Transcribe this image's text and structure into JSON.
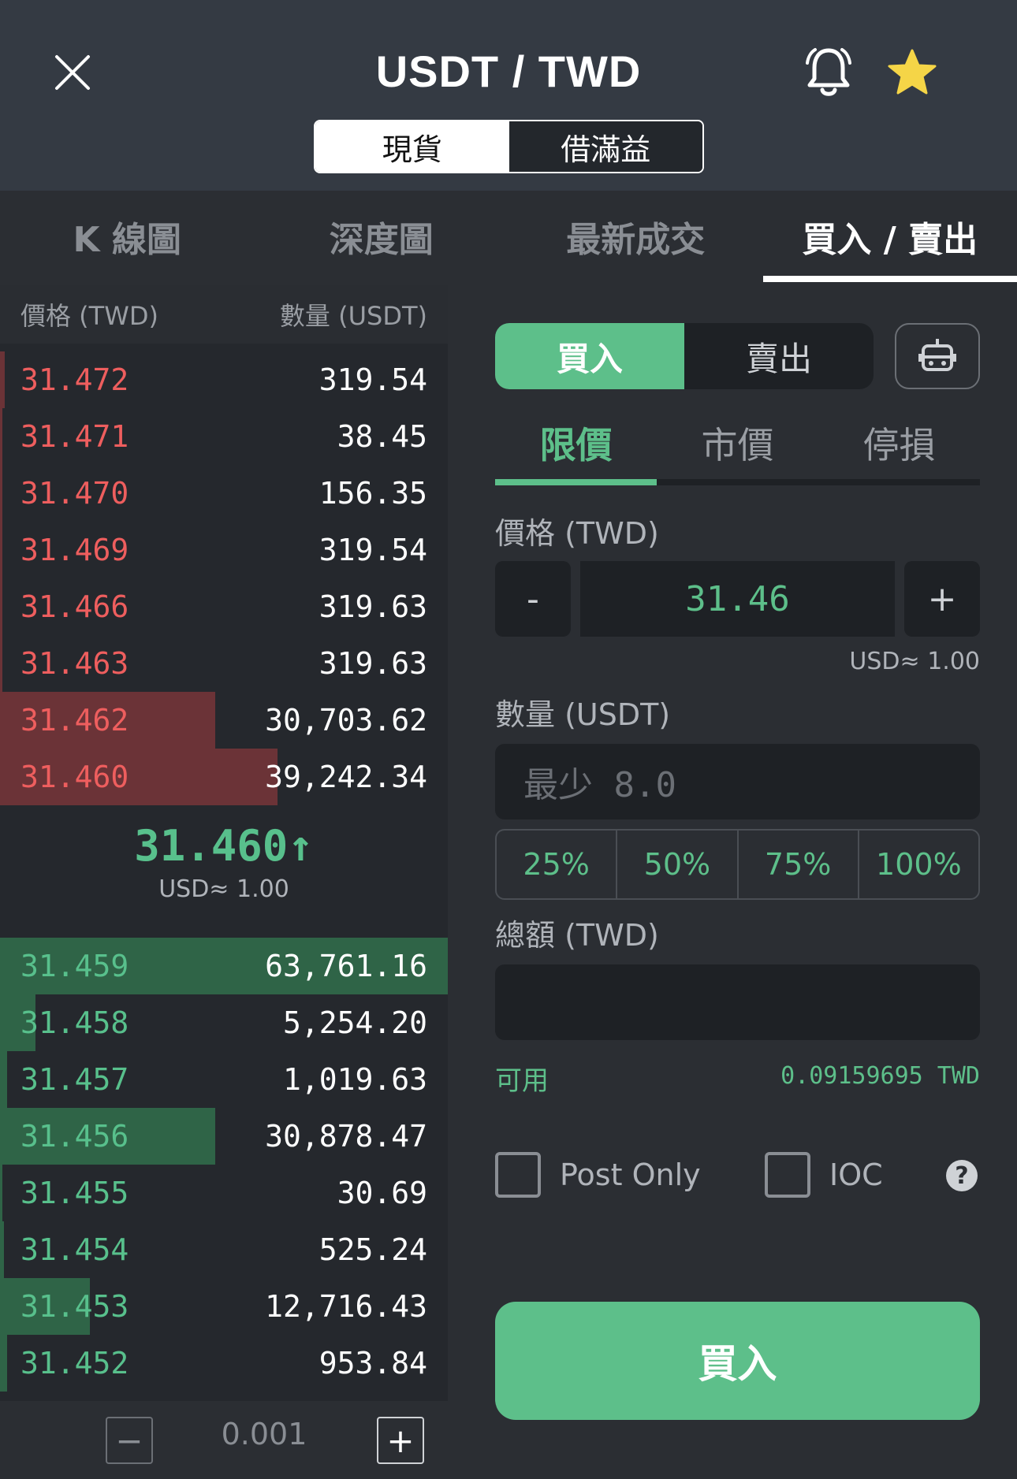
{
  "header": {
    "title": "USDT / TWD",
    "modes": [
      "現貨",
      "借滿益"
    ],
    "icons": [
      "close-icon",
      "bell-icon",
      "star-icon"
    ],
    "star_color": "#f5d547"
  },
  "tabs": [
    "K 線圖",
    "深度圖",
    "最新成交",
    "買入 / 賣出"
  ],
  "orderbook": {
    "price_header": "價格 (TWD)",
    "qty_header": "數量 (USDT)",
    "asks": [
      {
        "price": "31.472",
        "qty": "319.54",
        "depth": 0.01
      },
      {
        "price": "31.471",
        "qty": "38.45",
        "depth": 0.0
      },
      {
        "price": "31.470",
        "qty": "156.35",
        "depth": 0.0
      },
      {
        "price": "31.469",
        "qty": "319.54",
        "depth": 0.0
      },
      {
        "price": "31.466",
        "qty": "319.63",
        "depth": 0.0
      },
      {
        "price": "31.463",
        "qty": "319.63",
        "depth": 0.0
      },
      {
        "price": "31.462",
        "qty": "30,703.62",
        "depth": 0.48
      },
      {
        "price": "31.460",
        "qty": "39,242.34",
        "depth": 0.62
      }
    ],
    "mid_price": "31.460↑",
    "mid_usd": "USD≈ 1.00",
    "bids": [
      {
        "price": "31.459",
        "qty": "63,761.16",
        "depth": 1.0
      },
      {
        "price": "31.458",
        "qty": "5,254.20",
        "depth": 0.08
      },
      {
        "price": "31.457",
        "qty": "1,019.63",
        "depth": 0.016
      },
      {
        "price": "31.456",
        "qty": "30,878.47",
        "depth": 0.48
      },
      {
        "price": "31.455",
        "qty": "30.69",
        "depth": 0.0
      },
      {
        "price": "31.454",
        "qty": "525.24",
        "depth": 0.008
      },
      {
        "price": "31.453",
        "qty": "12,716.43",
        "depth": 0.2
      },
      {
        "price": "31.452",
        "qty": "953.84",
        "depth": 0.015
      }
    ],
    "step_value": "0.001",
    "ask_color": "#ee5e5e",
    "bid_color": "#58c08c"
  },
  "form": {
    "buy_label": "買入",
    "sell_label": "賣出",
    "order_types": [
      "限價",
      "市價",
      "停損"
    ],
    "price_label": "價格 (TWD)",
    "price_value": "31.46",
    "minus": "-",
    "plus": "+",
    "usd_eq": "USD≈ 1.00",
    "qty_label": "數量 (USDT)",
    "qty_placeholder": "最少 8.0",
    "percents": [
      "25%",
      "50%",
      "75%",
      "100%"
    ],
    "total_label": "總額 (TWD)",
    "available_label": "可用",
    "available_value": "0.09159695 TWD",
    "post_only": "Post Only",
    "ioc": "IOC",
    "help": "?",
    "submit": "買入",
    "accent": "#5dbf8a"
  }
}
